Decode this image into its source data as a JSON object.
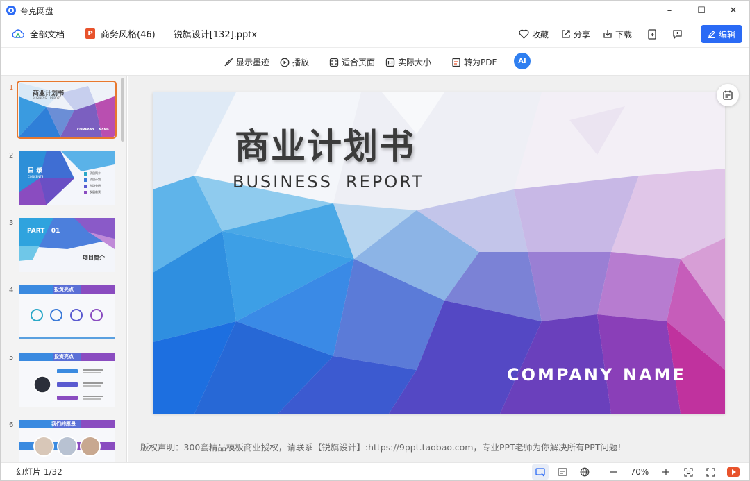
{
  "app": {
    "title": "夸克网盘"
  },
  "window_controls": {
    "minimize": "–",
    "maximize": "☐",
    "close": "✕"
  },
  "header": {
    "all_docs": "全部文档",
    "file_icon_letter": "P",
    "file_name": "商务风格(46)——锐旗设计[132].pptx",
    "favorite": "收藏",
    "share": "分享",
    "download": "下载",
    "edit": "编辑"
  },
  "toolbar": {
    "show_ink": "显示墨迹",
    "play": "播放",
    "fit_page": "适合页面",
    "actual_size": "实际大小",
    "to_pdf": "转为PDF",
    "ai": "AI"
  },
  "thumbnails": [
    {
      "number": "1",
      "title": "商业计划书",
      "sub": "BUSINESS    REPORT",
      "foot": "COMPANY    NAME"
    },
    {
      "number": "2",
      "title": "目 录",
      "sub": "CONCENTS",
      "items": [
        "项目简介",
        "项目计划",
        "市场分析",
        "发展前景"
      ]
    },
    {
      "number": "3",
      "title": "PART   01",
      "sub": "项目简介"
    },
    {
      "number": "4",
      "title": "投资亮点"
    },
    {
      "number": "5",
      "title": "投资亮点"
    },
    {
      "number": "6",
      "title": "我们的愿景"
    }
  ],
  "slide": {
    "title": "商业计划书",
    "sub_left": "BUSINESS",
    "sub_right": "REPORT",
    "company": "COMPANY",
    "name": "NAME"
  },
  "copyright": "版权声明：300套精品模板商业授权，请联系【锐旗设计】:https://9ppt.taobao.com，专业PPT老师为你解决所有PPT问题!",
  "status": {
    "slide_count": "幻灯片 1/32",
    "zoom": "70%"
  },
  "colors": {
    "accent": "#2a6af5",
    "ppt_orange": "#e8532c",
    "active_thumb": "#e8782e"
  }
}
